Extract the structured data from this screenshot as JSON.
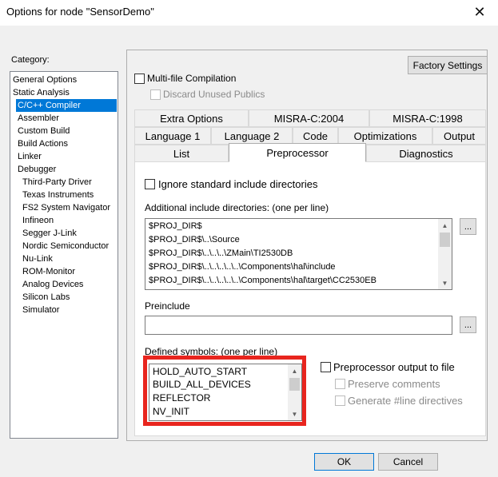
{
  "window": {
    "title": "Options for node \"SensorDemo\"",
    "close_glyph": "✕"
  },
  "category": {
    "label": "Category:",
    "items": [
      "General Options",
      "Static Analysis",
      "C/C++ Compiler",
      "Assembler",
      "Custom Build",
      "Build Actions",
      "Linker",
      "Debugger",
      "Third-Party Driver",
      "Texas Instruments",
      "FS2 System Navigator",
      "Infineon",
      "Segger J-Link",
      "Nordic Semiconductor",
      "Nu-Link",
      "ROM-Monitor",
      "Analog Devices",
      "Silicon Labs",
      "Simulator"
    ],
    "selected": "C/C++ Compiler"
  },
  "top": {
    "factory_settings": "Factory Settings",
    "multi_file": "Multi-file Compilation",
    "discard_unused": "Discard Unused Publics"
  },
  "tabs": {
    "row1": [
      "Extra Options",
      "MISRA-C:2004",
      "MISRA-C:1998"
    ],
    "row2": [
      "Language 1",
      "Language 2",
      "Code",
      "Optimizations",
      "Output"
    ],
    "row3": [
      "List",
      "Preprocessor",
      "Diagnostics"
    ],
    "active": "Preprocessor"
  },
  "preprocessor": {
    "ignore_std": "Ignore standard include directories",
    "additional_label": "Additional include directories: (one per line)",
    "include_dirs": [
      "$PROJ_DIR$",
      "$PROJ_DIR$\\..\\Source",
      "$PROJ_DIR$\\..\\..\\..\\ZMain\\TI2530DB",
      "$PROJ_DIR$\\..\\..\\..\\..\\..\\Components\\hal\\include",
      "$PROJ_DIR$\\..\\..\\..\\..\\..\\Components\\hal\\target\\CC2530EB"
    ],
    "preinclude_label": "Preinclude",
    "preinclude_value": "",
    "defined_label": "Defined symbols: (one per line)",
    "defined_symbols": [
      "HOLD_AUTO_START",
      "BUILD_ALL_DEVICES",
      "REFLECTOR",
      "NV_INIT"
    ],
    "pp_output": "Preprocessor output to file",
    "preserve_comments": "Preserve comments",
    "generate_line": "Generate #line directives",
    "browse_label": "...",
    "highlight_color": "#e8251e"
  },
  "footer": {
    "ok": "OK",
    "cancel": "Cancel"
  }
}
